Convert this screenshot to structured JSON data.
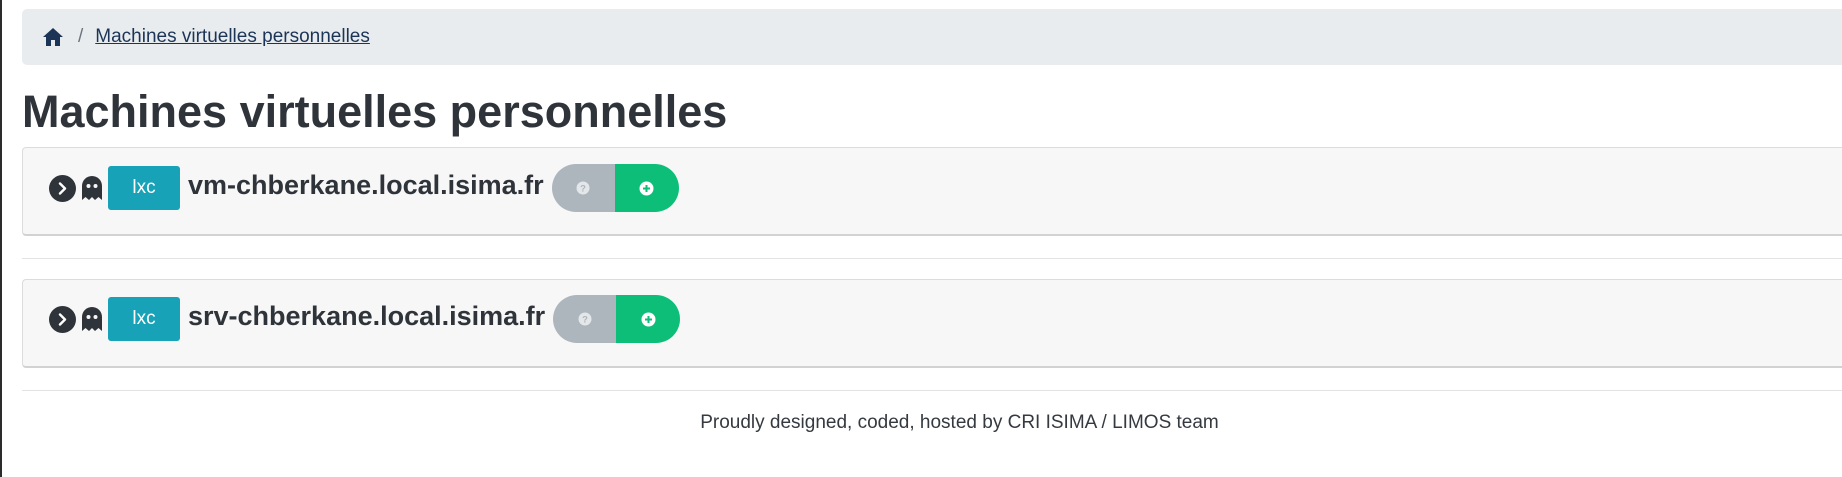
{
  "breadcrumb": {
    "home_icon": "home-icon",
    "separator": "/",
    "current": "Machines virtuelles personnelles"
  },
  "page": {
    "title": "Machines virtuelles personnelles"
  },
  "vms": [
    {
      "expand_icon": "chevron-right-circle-icon",
      "status_icon": "ghost-icon",
      "type": "lxc",
      "name": "vm-chberkane.local.isima.fr",
      "help_icon": "question-circle-icon",
      "add_icon": "plus-circle-icon"
    },
    {
      "expand_icon": "chevron-right-circle-icon",
      "status_icon": "ghost-icon",
      "type": "lxc",
      "name": "srv-chberkane.local.isima.fr",
      "help_icon": "question-circle-icon",
      "add_icon": "plus-circle-icon"
    }
  ],
  "footer": {
    "text": "Proudly designed, coded, hosted by CRI ISIMA / LIMOS team"
  },
  "colors": {
    "breadcrumb_bg": "#e9ecef",
    "badge_info": "#17a2b8",
    "btn_secondary": "#adb5bd",
    "btn_success": "#0dbe79",
    "text_dark": "#2f343a"
  }
}
